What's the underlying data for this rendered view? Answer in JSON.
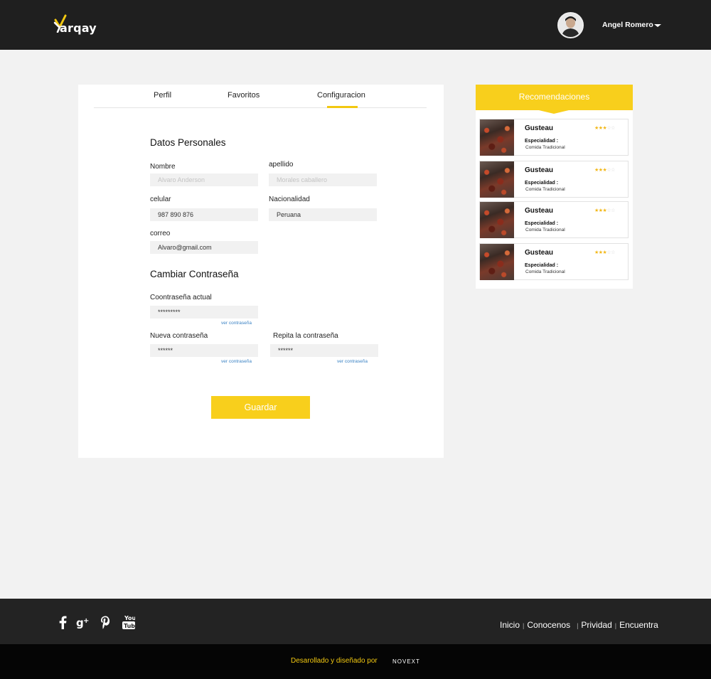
{
  "header": {
    "logo_text": "arqay",
    "user_name": "Angel Romero"
  },
  "tabs": [
    {
      "label": "Perfil"
    },
    {
      "label": "Favoritos"
    },
    {
      "label": "Configuracion",
      "active": true
    }
  ],
  "personal": {
    "title": "Datos Personales",
    "nombre": {
      "label": "Nombre",
      "placeholder": "Alvaro Anderson"
    },
    "apellido": {
      "label": "apellido",
      "placeholder": "Morales caballero"
    },
    "celular": {
      "label": "celular",
      "value": "987 890 876"
    },
    "nacionalidad": {
      "label": "Nacionalidad",
      "value": "Peruana"
    },
    "correo": {
      "label": "correo",
      "value": "Alvaro@gmail.com"
    }
  },
  "password": {
    "title": "Cambiar Contraseña",
    "actual": {
      "label": "Coontraseña actual",
      "value": "*********"
    },
    "nueva": {
      "label": "Nueva contraseña",
      "value": "******"
    },
    "repita": {
      "label": "Repita la contraseña",
      "value": "******"
    },
    "show_link": "ver contraseña"
  },
  "save_label": "Guardar",
  "recommendations": {
    "title": "Recomendaciones",
    "items": [
      {
        "name": "Gusteau",
        "rating": 3,
        "max": 5,
        "spec_label": "Especialidad :",
        "spec_value": "Comida Tradicional"
      },
      {
        "name": "Gusteau",
        "rating": 3,
        "max": 5,
        "spec_label": "Especialidad :",
        "spec_value": "Comida Tradicional"
      },
      {
        "name": "Gusteau",
        "rating": 3,
        "max": 5,
        "spec_label": "Especialidad :",
        "spec_value": "Comida Tradicional"
      },
      {
        "name": "Gusteau",
        "rating": 3,
        "max": 5,
        "spec_label": "Especialidad :",
        "spec_value": "Comida Tradicional"
      }
    ]
  },
  "footer": {
    "links": [
      "Inicio",
      "Conocenos",
      "Prividad",
      "Encuentra"
    ],
    "credit": "Desarollado y diseñado por",
    "brand": "NOVEXT"
  },
  "colors": {
    "accent": "#f8cf1c",
    "header_bg": "#1f1f1f",
    "footer_bg": "#232323",
    "bottom_bar_bg": "#050505"
  }
}
